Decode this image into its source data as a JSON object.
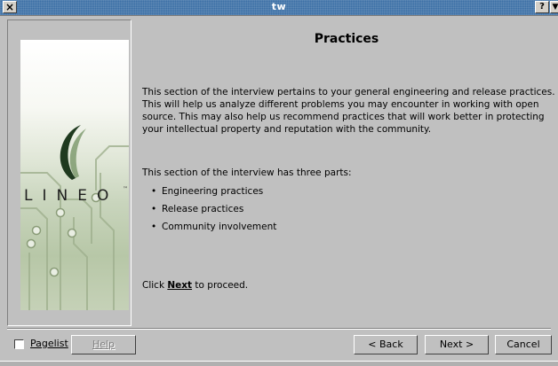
{
  "window": {
    "title": "tw",
    "close_symbol": "×",
    "help_symbol": "?",
    "menu_symbol": "▼"
  },
  "sidebar": {
    "logo_text": "LINEO",
    "logo_trademark": "™"
  },
  "content": {
    "title": "Practices",
    "paragraph1": "This section of the interview pertains to your general engineering and release practices. This will help us analyze different problems you may encounter in working with open source. This may also help us recommend practices that will work better in protecting your intellectual property and reputation with the community.",
    "paragraph2": "This section of the interview has three parts:",
    "parts": [
      "Engineering practices",
      "Release practices",
      "Community involvement"
    ],
    "proceed_prefix": "Click ",
    "proceed_bold": "Next",
    "proceed_suffix": " to proceed."
  },
  "footer": {
    "pagelist_label": "Pagelist",
    "pagelist_checked": false,
    "help_label": "Help",
    "back_label": "< Back",
    "next_label": "Next >",
    "cancel_label": "Cancel"
  }
}
